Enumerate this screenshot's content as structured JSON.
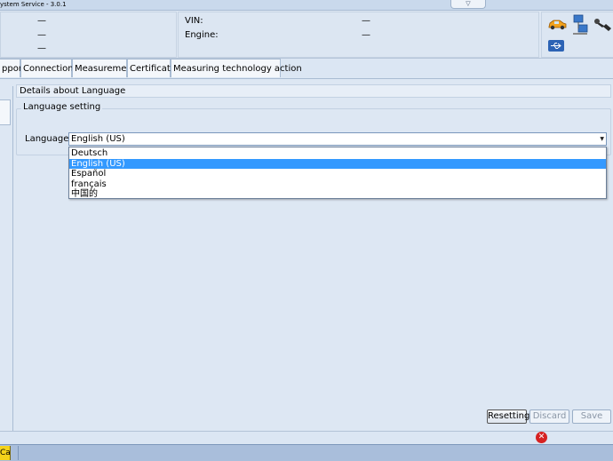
{
  "window": {
    "title": "ystem Service - 3.0.1",
    "collapse_glyph": "▽"
  },
  "info": {
    "left_values": [
      "—",
      "—",
      "—"
    ],
    "vin_label": "VIN:",
    "vin_value": "—",
    "engine_label": "Engine:",
    "engine_value": "—",
    "icons": [
      "car-icon",
      "network-icon",
      "key-icon",
      "usb-icon"
    ]
  },
  "tabs": [
    {
      "label": "pport"
    },
    {
      "label": "Connections"
    },
    {
      "label": "Measurement"
    },
    {
      "label": "Certificate"
    },
    {
      "label": "Measuring technology action"
    }
  ],
  "details": {
    "title": "Details about Language",
    "group_label": "Language setting",
    "language_label": "Language",
    "selected": "English (US)",
    "options": [
      "Deutsch",
      "English (US)",
      "Español",
      "français",
      "中国的"
    ],
    "selected_index": 1
  },
  "buttons": {
    "reset": "Resetting",
    "discard": "Discard",
    "save": "Save"
  },
  "status": {
    "error_glyph": "✕",
    "indicator": "Ca"
  },
  "colors": {
    "selection": "#3399ff",
    "error": "#d62222",
    "background": "#dde7f3"
  }
}
